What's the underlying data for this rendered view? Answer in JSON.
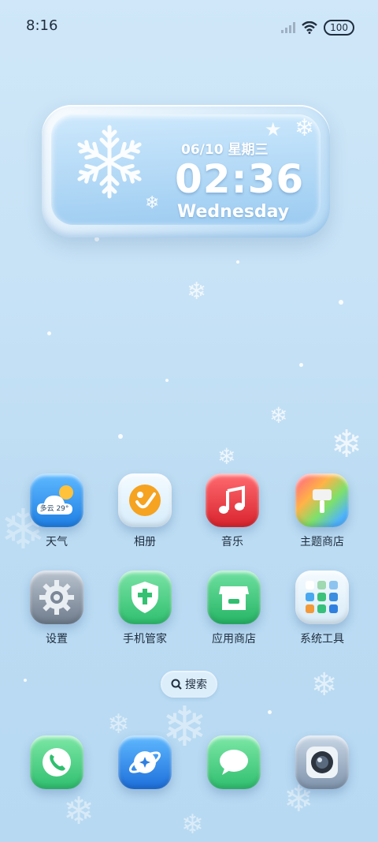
{
  "status_bar": {
    "time": "8:16",
    "battery": "100"
  },
  "clock_widget": {
    "date": "06/10  星期三",
    "time": "02:36",
    "weekday": "Wednesday"
  },
  "weather_icon_text": "多云 29°",
  "apps": [
    {
      "label": "天气"
    },
    {
      "label": "相册"
    },
    {
      "label": "音乐"
    },
    {
      "label": "主题商店"
    },
    {
      "label": "设置"
    },
    {
      "label": "手机管家"
    },
    {
      "label": "应用商店"
    },
    {
      "label": "系统工具"
    }
  ],
  "search": {
    "label": "搜索"
  },
  "dock": [
    "phone-icon",
    "browser-icon",
    "messages-icon",
    "camera-icon"
  ]
}
